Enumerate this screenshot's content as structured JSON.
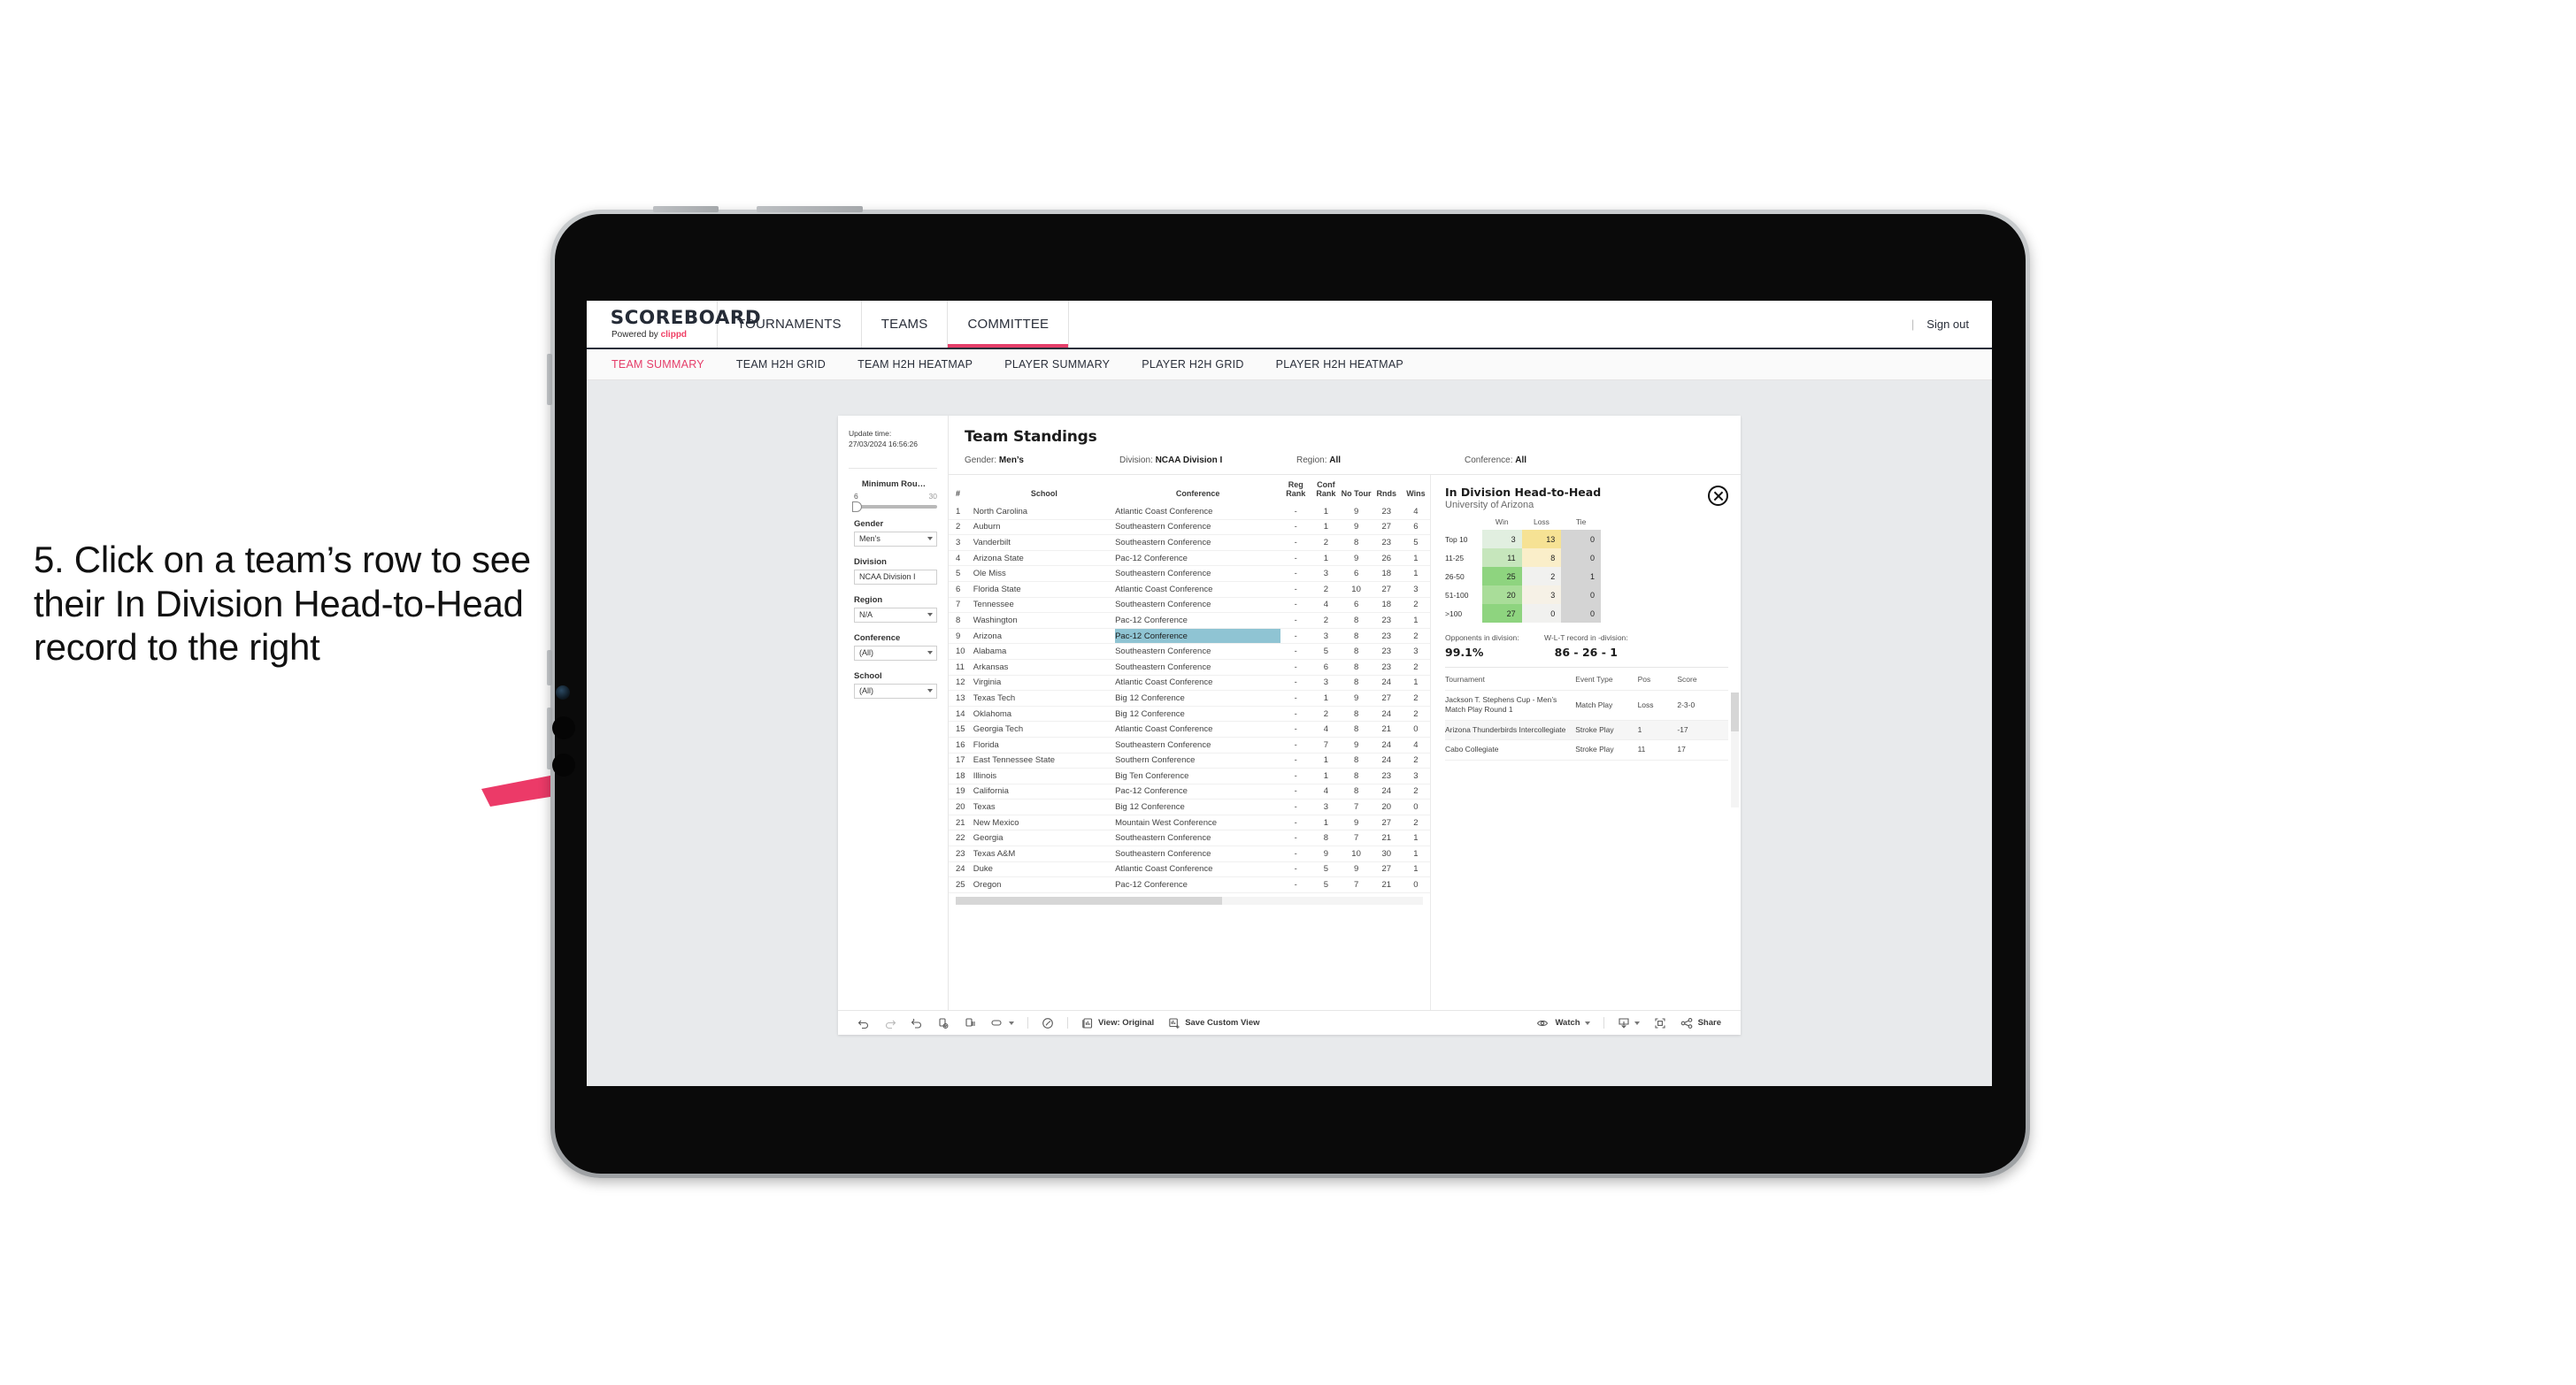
{
  "annotation": {
    "text": "5. Click on a team’s row to see their In Division Head-to-Head record to the right",
    "arrow_color": "#ec3a68"
  },
  "topnav": {
    "logo": "SCOREBOARD",
    "logo_sub_prefix": "Powered by ",
    "logo_sub_brand": "clippd",
    "items": [
      {
        "label": "TOURNAMENTS",
        "active": false
      },
      {
        "label": "TEAMS",
        "active": false
      },
      {
        "label": "COMMITTEE",
        "active": true
      }
    ],
    "divider": "|",
    "signout": "Sign out",
    "accent": "#e53e6a"
  },
  "subnav": {
    "items": [
      {
        "label": "TEAM SUMMARY",
        "active": true
      },
      {
        "label": "TEAM H2H GRID",
        "active": false
      },
      {
        "label": "TEAM H2H HEATMAP",
        "active": false
      },
      {
        "label": "PLAYER SUMMARY",
        "active": false
      },
      {
        "label": "PLAYER H2H GRID",
        "active": false
      },
      {
        "label": "PLAYER H2H HEATMAP",
        "active": false
      }
    ]
  },
  "filters": {
    "update_time_label": "Update time:",
    "update_time_value": "27/03/2024 16:56:26",
    "slider": {
      "label": "Minimum Rou…",
      "min": "6",
      "max": "30"
    },
    "selects": [
      {
        "label": "Gender",
        "value": "Men’s",
        "has_caret": true
      },
      {
        "label": "Division",
        "value": "NCAA Division I",
        "has_caret": false
      },
      {
        "label": "Region",
        "value": "N/A",
        "has_caret": true
      },
      {
        "label": "Conference",
        "value": "(All)",
        "has_caret": true
      },
      {
        "label": "School",
        "value": "(All)",
        "has_caret": true
      }
    ]
  },
  "standings": {
    "title": "Team Standings",
    "meta": [
      {
        "label": "Gender:",
        "value": "Men’s"
      },
      {
        "label": "Division:",
        "value": "NCAA Division I"
      },
      {
        "label": "Region:",
        "value": "All"
      },
      {
        "label": "Conference:",
        "value": "All"
      }
    ],
    "columns": [
      "#",
      "School",
      "Conference",
      "Reg Rank",
      "Conf Rank",
      "No Tour",
      "Rnds",
      "Wins"
    ],
    "rows": [
      {
        "n": "1",
        "school": "North Carolina",
        "conf": "Atlantic Coast Conference",
        "reg": "-",
        "cr": "1",
        "nt": "9",
        "rnds": "23",
        "wins": "4",
        "selected": false
      },
      {
        "n": "2",
        "school": "Auburn",
        "conf": "Southeastern Conference",
        "reg": "-",
        "cr": "1",
        "nt": "9",
        "rnds": "27",
        "wins": "6",
        "selected": false
      },
      {
        "n": "3",
        "school": "Vanderbilt",
        "conf": "Southeastern Conference",
        "reg": "-",
        "cr": "2",
        "nt": "8",
        "rnds": "23",
        "wins": "5",
        "selected": false
      },
      {
        "n": "4",
        "school": "Arizona State",
        "conf": "Pac-12 Conference",
        "reg": "-",
        "cr": "1",
        "nt": "9",
        "rnds": "26",
        "wins": "1",
        "selected": false
      },
      {
        "n": "5",
        "school": "Ole Miss",
        "conf": "Southeastern Conference",
        "reg": "-",
        "cr": "3",
        "nt": "6",
        "rnds": "18",
        "wins": "1",
        "selected": false
      },
      {
        "n": "6",
        "school": "Florida State",
        "conf": "Atlantic Coast Conference",
        "reg": "-",
        "cr": "2",
        "nt": "10",
        "rnds": "27",
        "wins": "3",
        "selected": false
      },
      {
        "n": "7",
        "school": "Tennessee",
        "conf": "Southeastern Conference",
        "reg": "-",
        "cr": "4",
        "nt": "6",
        "rnds": "18",
        "wins": "2",
        "selected": false
      },
      {
        "n": "8",
        "school": "Washington",
        "conf": "Pac-12 Conference",
        "reg": "-",
        "cr": "2",
        "nt": "8",
        "rnds": "23",
        "wins": "1",
        "selected": false
      },
      {
        "n": "9",
        "school": "Arizona",
        "conf": "Pac-12 Conference",
        "reg": "-",
        "cr": "3",
        "nt": "8",
        "rnds": "23",
        "wins": "2",
        "selected": true
      },
      {
        "n": "10",
        "school": "Alabama",
        "conf": "Southeastern Conference",
        "reg": "-",
        "cr": "5",
        "nt": "8",
        "rnds": "23",
        "wins": "3",
        "selected": false
      },
      {
        "n": "11",
        "school": "Arkansas",
        "conf": "Southeastern Conference",
        "reg": "-",
        "cr": "6",
        "nt": "8",
        "rnds": "23",
        "wins": "2",
        "selected": false
      },
      {
        "n": "12",
        "school": "Virginia",
        "conf": "Atlantic Coast Conference",
        "reg": "-",
        "cr": "3",
        "nt": "8",
        "rnds": "24",
        "wins": "1",
        "selected": false
      },
      {
        "n": "13",
        "school": "Texas Tech",
        "conf": "Big 12 Conference",
        "reg": "-",
        "cr": "1",
        "nt": "9",
        "rnds": "27",
        "wins": "2",
        "selected": false
      },
      {
        "n": "14",
        "school": "Oklahoma",
        "conf": "Big 12 Conference",
        "reg": "-",
        "cr": "2",
        "nt": "8",
        "rnds": "24",
        "wins": "2",
        "selected": false
      },
      {
        "n": "15",
        "school": "Georgia Tech",
        "conf": "Atlantic Coast Conference",
        "reg": "-",
        "cr": "4",
        "nt": "8",
        "rnds": "21",
        "wins": "0",
        "selected": false
      },
      {
        "n": "16",
        "school": "Florida",
        "conf": "Southeastern Conference",
        "reg": "-",
        "cr": "7",
        "nt": "9",
        "rnds": "24",
        "wins": "4",
        "selected": false
      },
      {
        "n": "17",
        "school": "East Tennessee State",
        "conf": "Southern Conference",
        "reg": "-",
        "cr": "1",
        "nt": "8",
        "rnds": "24",
        "wins": "2",
        "selected": false
      },
      {
        "n": "18",
        "school": "Illinois",
        "conf": "Big Ten Conference",
        "reg": "-",
        "cr": "1",
        "nt": "8",
        "rnds": "23",
        "wins": "3",
        "selected": false
      },
      {
        "n": "19",
        "school": "California",
        "conf": "Pac-12 Conference",
        "reg": "-",
        "cr": "4",
        "nt": "8",
        "rnds": "24",
        "wins": "2",
        "selected": false
      },
      {
        "n": "20",
        "school": "Texas",
        "conf": "Big 12 Conference",
        "reg": "-",
        "cr": "3",
        "nt": "7",
        "rnds": "20",
        "wins": "0",
        "selected": false
      },
      {
        "n": "21",
        "school": "New Mexico",
        "conf": "Mountain West Conference",
        "reg": "-",
        "cr": "1",
        "nt": "9",
        "rnds": "27",
        "wins": "2",
        "selected": false
      },
      {
        "n": "22",
        "school": "Georgia",
        "conf": "Southeastern Conference",
        "reg": "-",
        "cr": "8",
        "nt": "7",
        "rnds": "21",
        "wins": "1",
        "selected": false
      },
      {
        "n": "23",
        "school": "Texas A&M",
        "conf": "Southeastern Conference",
        "reg": "-",
        "cr": "9",
        "nt": "10",
        "rnds": "30",
        "wins": "1",
        "selected": false
      },
      {
        "n": "24",
        "school": "Duke",
        "conf": "Atlantic Coast Conference",
        "reg": "-",
        "cr": "5",
        "nt": "9",
        "rnds": "27",
        "wins": "1",
        "selected": false
      },
      {
        "n": "25",
        "school": "Oregon",
        "conf": "Pac-12 Conference",
        "reg": "-",
        "cr": "5",
        "nt": "7",
        "rnds": "21",
        "wins": "0",
        "selected": false
      }
    ]
  },
  "h2h": {
    "title": "In Division Head-to-Head",
    "subtitle": "University of Arizona",
    "close_label": "×",
    "columns": [
      "Win",
      "Loss",
      "Tie"
    ],
    "matrix": [
      {
        "band": "Top 10",
        "win": "3",
        "loss": "13",
        "tie": "0",
        "win_color": "#e1efe0",
        "loss_color": "#f6e294",
        "tie_color": "#d4d4d4"
      },
      {
        "band": "11-25",
        "win": "11",
        "loss": "8",
        "tie": "0",
        "win_color": "#c6e6bc",
        "loss_color": "#faeec9",
        "tie_color": "#d4d4d4"
      },
      {
        "band": "26-50",
        "win": "25",
        "loss": "2",
        "tie": "1",
        "win_color": "#8ed47f",
        "loss_color": "#f1f1ef",
        "tie_color": "#d4d4d4"
      },
      {
        "band": "51-100",
        "win": "20",
        "loss": "3",
        "tie": "0",
        "win_color": "#a9dd99",
        "loss_color": "#f6f1e6",
        "tie_color": "#d4d4d4"
      },
      {
        "band": ">100",
        "win": "27",
        "loss": "0",
        "tie": "0",
        "win_color": "#8ed47f",
        "loss_color": "#f1f1ef",
        "tie_color": "#d4d4d4"
      }
    ],
    "stats": [
      {
        "label": "Opponents in division:",
        "value": "99.1%"
      },
      {
        "label": "W-L-T record in -division:",
        "value": "86 - 26 - 1"
      }
    ],
    "tour_columns": [
      "Tournament",
      "Event Type",
      "Pos",
      "Score"
    ],
    "tour_rows": [
      {
        "name": "Jackson T. Stephens Cup - Men’s Match Play Round 1",
        "type": "Match Play",
        "pos": "Loss",
        "score": "2-3-0"
      },
      {
        "name": "Arizona Thunderbirds Intercollegiate",
        "type": "Stroke Play",
        "pos": "1",
        "score": "-17"
      },
      {
        "name": "Cabo Collegiate",
        "type": "Stroke Play",
        "pos": "11",
        "score": "17"
      }
    ]
  },
  "toolbar": {
    "view_label": "View: Original",
    "save_label": "Save Custom View",
    "watch_label": "Watch",
    "share_label": "Share"
  }
}
